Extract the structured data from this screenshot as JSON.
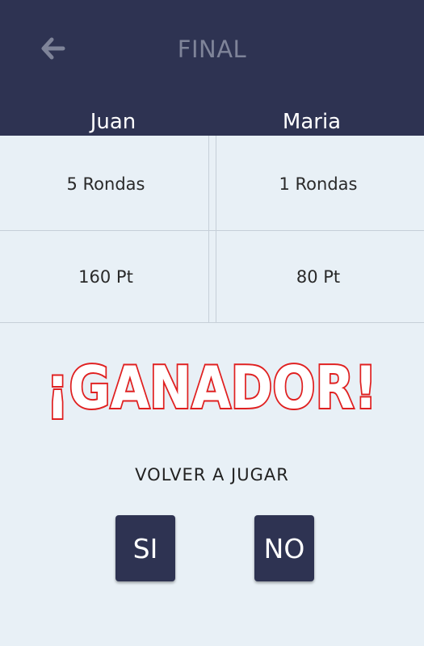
{
  "header": {
    "title": "FINAL",
    "back_icon": "arrow-left-icon"
  },
  "players": [
    {
      "name": "Juan",
      "rounds": "5 Rondas",
      "points": "160 Pt"
    },
    {
      "name": "Maria",
      "rounds": "1 Rondas",
      "points": "80 Pt"
    }
  ],
  "result": {
    "winner_text": "¡GANADOR!"
  },
  "replay": {
    "label": "VOLVER A JUGAR",
    "yes_label": "SI",
    "no_label": "NO"
  },
  "colors": {
    "header_bg": "#2e3352",
    "body_bg": "#e8f0f6",
    "winner_red": "#e02020",
    "button_bg": "#2e3352"
  }
}
